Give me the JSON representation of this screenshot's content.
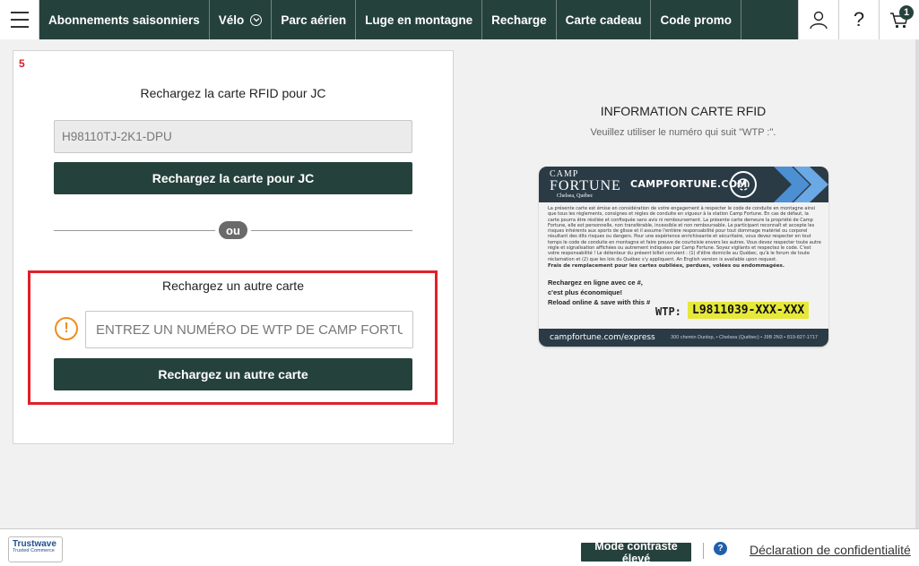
{
  "nav": {
    "items": [
      {
        "label": "Abonnements saisonniers"
      },
      {
        "label": "Vélo"
      },
      {
        "label": "Parc aérien"
      },
      {
        "label": "Luge en montagne"
      },
      {
        "label": "Recharge"
      },
      {
        "label": "Carte cadeau"
      },
      {
        "label": "Code promo"
      }
    ],
    "help_label": "?",
    "cart_count": "1",
    "icons": [
      "menu-icon",
      "chevron-down-icon",
      "user-icon",
      "help-icon",
      "cart-icon"
    ]
  },
  "panel": {
    "step": "5",
    "recharge_title": "Rechargez la carte RFID pour JC",
    "rfid_value": "H98110TJ-2K1-DPU",
    "recharge_button": "Rechargez la carte pour JC",
    "divider_label": "ou",
    "other_title": "Rechargez un autre carte",
    "wtp_placeholder": "ENTREZ UN NUMÉRO DE WTP DE CAMP FORTUNE",
    "warning_glyph": "!",
    "other_button": "Rechargez un autre carte"
  },
  "info": {
    "title": "INFORMATION CARTE RFID",
    "subtitle": "Veuillez utiliser le numéro qui suit \"WTP :\"."
  },
  "card": {
    "brand_line1": "CAMP",
    "brand_line2": "FORTUNE",
    "brand_line3": "Chelsea, Québec",
    "site": "CAMPFORTUNE.COM",
    "fine_print": "La présente carte est émise en considération de votre engagement à respecter le code de conduite en montagne ainsi que tous les règlements, consignes et règles de conduite en vigueur à la station Camp Fortune. En cas de défaut, la carte pourra être résiliée et confisquée sans avis ni remboursement. La présente carte demeure la propriété de Camp Fortune, elle est personnelle, non transférable, incessible et non remboursable. Le participant reconnaît et accepte les risques inhérents aux sports de glisse et il assume l'entière responsabilité pour tout dommage matériel ou corporel résultant des dits risques ou dangers. Pour une expérience enrichissante et sécuritaire, vous devez respecter en tout temps le code de conduite en montagne et faire preuve de courtoisie envers les autres. Vous devez respecter toute autre règle et signalisation affichées ou autrement indiquées par Camp Fortune. Soyez vigilants et respectez le code. C'est votre responsabilité ! Le détenteur du présent billet convient : (1) d'élire domicile au Québec, qu'à le forum de toute réclamation et (2) que les lois du Québec s'y appliquent. An English version is available upon request.",
    "fees_line": "Frais de remplacement pour les cartes oubliées, perdues, volées ou endommagées.",
    "reload_line1": "Rechargez en ligne avec ce #,",
    "reload_line2": "c'est plus économique!",
    "reload_line3": "Reload online & save with this #",
    "wtp_label": "WTP:",
    "wtp_value": "L9811039-XXX-XXX",
    "bottom_url": "campfortune.com/express",
    "bottom_address": "300 chemin Dunlop, • Chelsea (Québec) • J9B 2N3 • 819-827-1717"
  },
  "footer": {
    "trustwave_line1": "Trustwave",
    "trustwave_line2": "Trusted Commerce",
    "contrast_button": "Mode contraste élevé",
    "help_glyph": "?",
    "privacy_link": "Déclaration de confidentialité"
  },
  "colors": {
    "brand_dark_green": "#25413b",
    "highlight_red": "#e02029",
    "warning_orange": "#f08c1a",
    "wtp_yellow": "#e6e83a",
    "help_blue": "#1f5fae"
  }
}
